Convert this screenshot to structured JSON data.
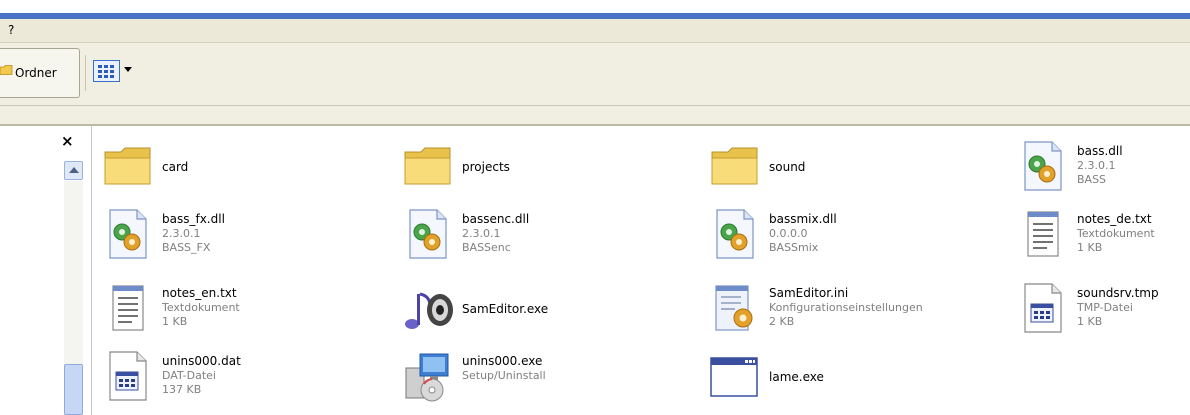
{
  "menu": {
    "help": "?"
  },
  "toolbar": {
    "folders_label": "Ordner"
  },
  "files": [
    {
      "name": "card",
      "lines": [],
      "icon": "folder-icon"
    },
    {
      "name": "projects",
      "lines": [],
      "icon": "folder-icon"
    },
    {
      "name": "sound",
      "lines": [],
      "icon": "folder-icon"
    },
    {
      "name": "bass.dll",
      "lines": [
        "2.3.0.1",
        "BASS"
      ],
      "icon": "dll-gear-icon"
    },
    {
      "name": "bass_fx.dll",
      "lines": [
        "2.3.0.1",
        "BASS_FX"
      ],
      "icon": "dll-gear-icon"
    },
    {
      "name": "bassenc.dll",
      "lines": [
        "2.3.0.1",
        "BASSenc"
      ],
      "icon": "dll-gear-icon"
    },
    {
      "name": "bassmix.dll",
      "lines": [
        "0.0.0.0",
        "BASSmix"
      ],
      "icon": "dll-gear-icon"
    },
    {
      "name": "notes_de.txt",
      "lines": [
        "Textdokument",
        "1 KB"
      ],
      "icon": "text-document-icon"
    },
    {
      "name": "notes_en.txt",
      "lines": [
        "Textdokument",
        "1 KB"
      ],
      "icon": "text-document-icon"
    },
    {
      "name": "SamEditor.exe",
      "lines": [],
      "icon": "audio-speaker-icon"
    },
    {
      "name": "SamEditor.ini",
      "lines": [
        "Konfigurationseinstellungen",
        "2 KB"
      ],
      "icon": "config-file-icon"
    },
    {
      "name": "soundsrv.tmp",
      "lines": [
        "TMP-Datei",
        "1 KB"
      ],
      "icon": "generic-file-icon"
    },
    {
      "name": "unins000.dat",
      "lines": [
        "DAT-Datei",
        "137 KB"
      ],
      "icon": "generic-file-icon"
    },
    {
      "name": "unins000.exe",
      "lines": [
        "Setup/Uninstall"
      ],
      "icon": "setup-icon"
    },
    {
      "name": "lame.exe",
      "lines": [],
      "icon": "application-window-icon"
    }
  ]
}
